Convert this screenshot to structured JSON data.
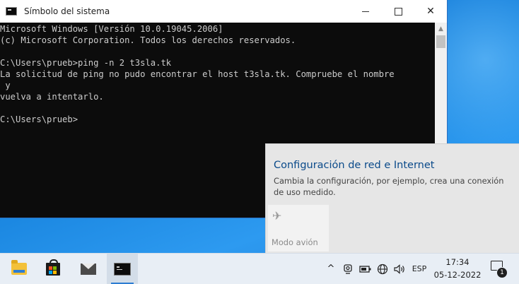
{
  "window": {
    "title": "Símbolo del sistema",
    "buttons": {
      "minimize": "minimize-icon",
      "maximize": "maximize-icon",
      "close": "✕"
    }
  },
  "console": {
    "lines": [
      "Microsoft Windows [Versión 10.0.19045.2006]",
      "(c) Microsoft Corporation. Todos los derechos reservados.",
      "",
      "C:\\Users\\prueb>ping -n 2 t3sla.tk",
      "La solicitud de ping no pudo encontrar el host t3sla.tk. Compruebe el nombre",
      " y",
      "vuelva a intentarlo.",
      "",
      "C:\\Users\\prueb>"
    ]
  },
  "network_flyout": {
    "title": "Configuración de red e Internet",
    "description": "Cambia la configuración, por ejemplo, crea una conexión de uso medido.",
    "tiles": [
      {
        "label": "Modo avión",
        "icon": "airplane-icon",
        "state": "off"
      }
    ]
  },
  "taskbar": {
    "apps": [
      {
        "name": "file-explorer",
        "icon": "folder-icon"
      },
      {
        "name": "microsoft-store",
        "icon": "store-icon"
      },
      {
        "name": "mail",
        "icon": "mail-icon"
      },
      {
        "name": "command-prompt",
        "icon": "cmd-icon",
        "active": true
      }
    ],
    "tray": {
      "chevron": "^",
      "language": "ESP",
      "time": "17:34",
      "date": "05-12-2022",
      "notification_count": "1"
    }
  },
  "colors": {
    "console_bg": "#0c0c0c",
    "console_fg": "#cccccc",
    "accent": "#0a4a8a",
    "desktop": "#1a86e0"
  }
}
